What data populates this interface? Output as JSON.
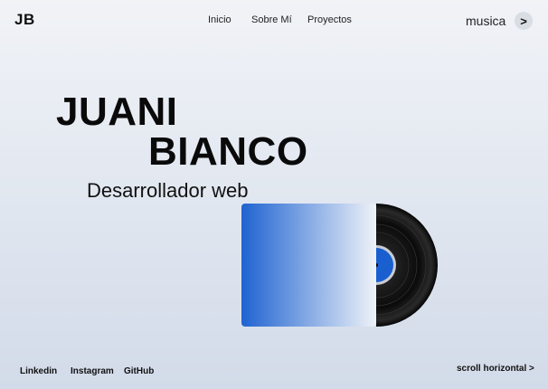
{
  "header": {
    "logo": "JB",
    "nav": [
      "Inicio",
      "Sobre Mí",
      "Proyectos"
    ],
    "music_label": "musica",
    "music_button": ">"
  },
  "hero": {
    "name_line1": "JUANI",
    "name_line2": "BIANCO",
    "role": "Desarrollador web"
  },
  "album": {
    "cover_gradient": [
      "#1f63d1",
      "#eef2f8"
    ],
    "vinyl_color": "#0b0b0b",
    "label_color": "#1a5fcf"
  },
  "footer": {
    "links": [
      "Linkedin",
      "Instagram",
      "GitHub"
    ],
    "scroll_hint": "scroll horizontal >"
  }
}
